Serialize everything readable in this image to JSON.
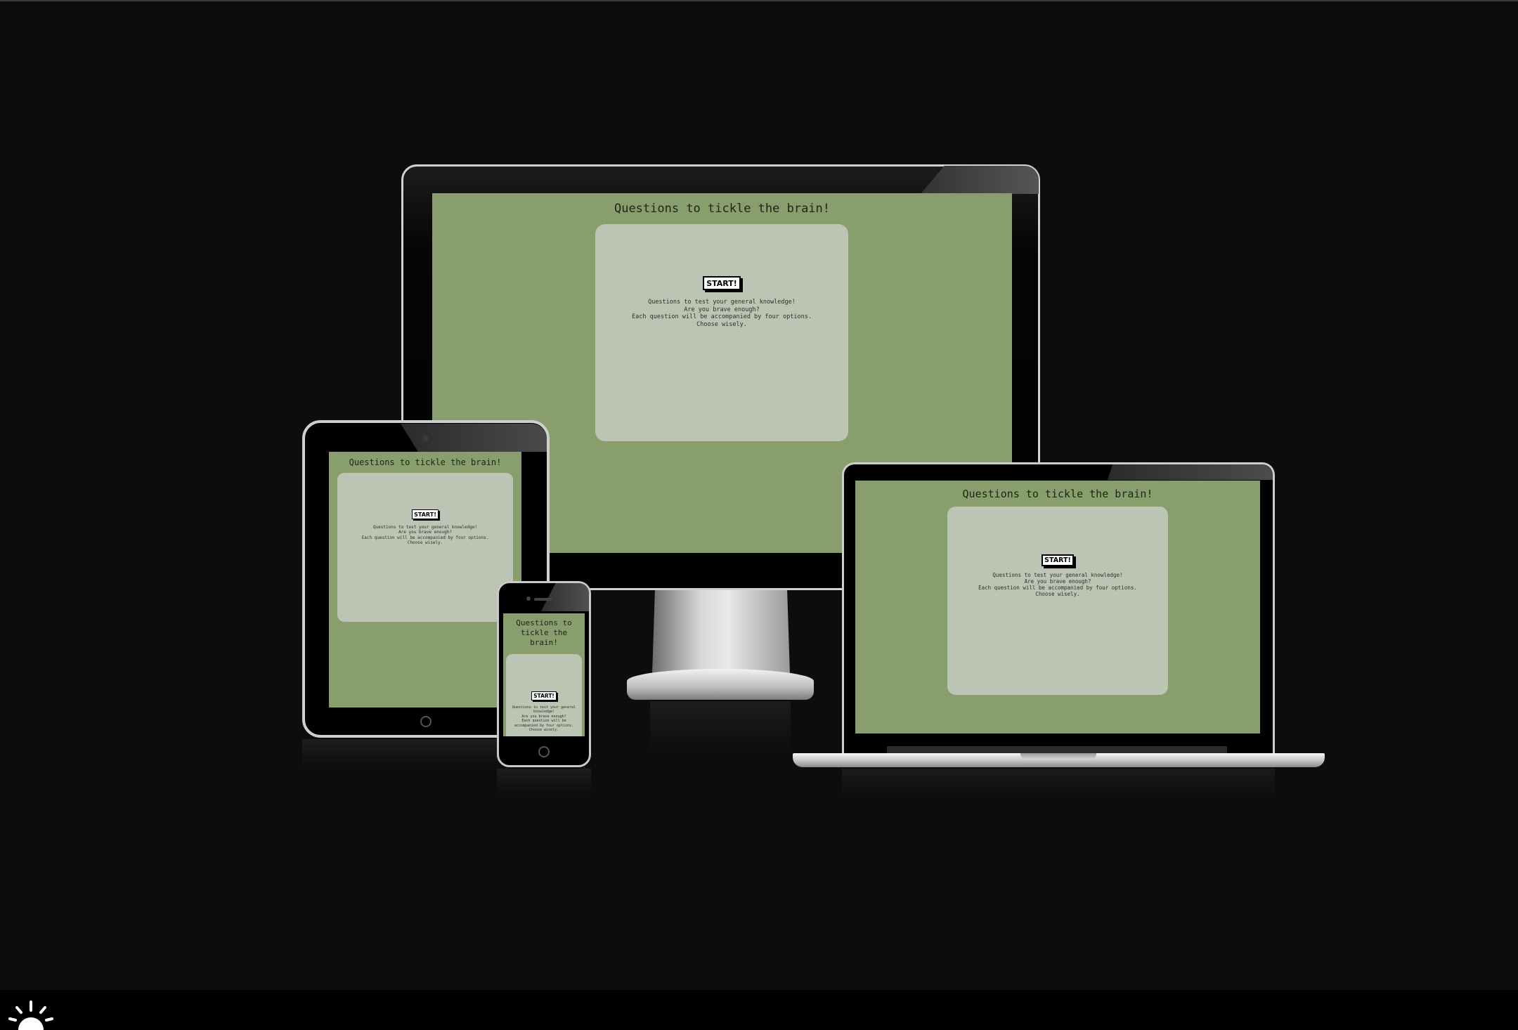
{
  "app": {
    "title": "Questions to tickle the brain!",
    "start_label": "START!",
    "intro_lines": [
      "Questions to test your general knowledge!",
      "Are you brave enough?",
      "Each question will be accompanied by four options.",
      "Choose wisely."
    ]
  },
  "phone": {
    "title_lines": [
      "Questions to",
      "tickle the",
      "brain!"
    ],
    "intro_lines": [
      "Questions to test your general",
      "knowledge!",
      "Are you brave enough?",
      "Each question will be",
      "accompanied by four options.",
      "Choose wisely."
    ]
  },
  "colors": {
    "background": "#0e0d0e",
    "screen_green": "#889e6c",
    "card_gray": "#bcc4b3",
    "button_bg": "#ffffff",
    "button_border": "#000000"
  },
  "icons": {
    "theme_toggle": "sun-icon"
  }
}
